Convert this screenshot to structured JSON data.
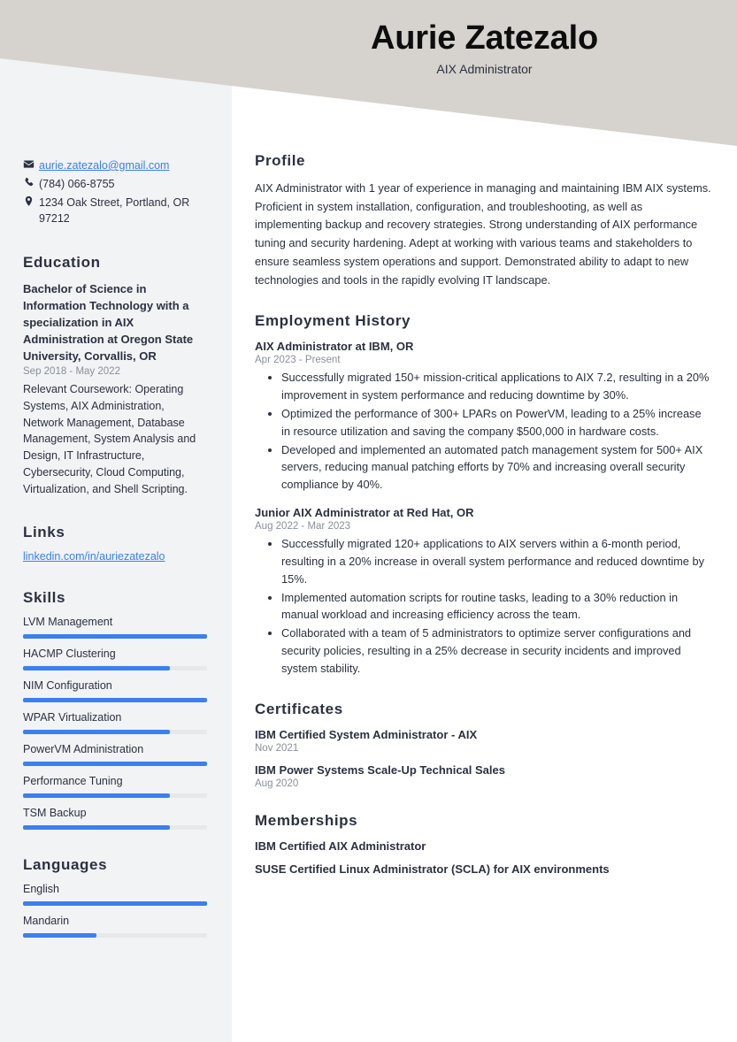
{
  "header": {
    "name": "Aurie Zatezalo",
    "job_title": "AIX Administrator",
    "band_color": "#d6d2cd"
  },
  "theme": {
    "accent": "#3b7ff0",
    "sidebar_bg": "#f1f3f5",
    "text": "#2c3040",
    "muted": "#8a8f98"
  },
  "sidebar": {
    "contact": [
      {
        "icon": "envelope-icon",
        "value": "aurie.zatezalo@gmail.com",
        "is_link": true
      },
      {
        "icon": "phone-icon",
        "value": "(784) 066-8755",
        "is_link": false
      },
      {
        "icon": "location-pin-icon",
        "value": "1234 Oak Street, Portland, OR 97212",
        "is_link": false
      }
    ],
    "education": {
      "heading": "Education",
      "degree": "Bachelor of Science in Information Technology with a specialization in AIX Administration at Oregon State University, Corvallis, OR",
      "date": "Sep 2018 - May 2022",
      "description": "Relevant Coursework: Operating Systems, AIX Administration, Network Management, Database Management, System Analysis and Design, IT Infrastructure, Cybersecurity, Cloud Computing, Virtualization, and Shell Scripting."
    },
    "links": {
      "heading": "Links",
      "items": [
        {
          "label": "linkedin.com/in/auriezatezalo"
        }
      ]
    },
    "skills": {
      "heading": "Skills",
      "items": [
        {
          "label": "LVM Management",
          "level": 100
        },
        {
          "label": "HACMP Clustering",
          "level": 80
        },
        {
          "label": "NIM Configuration",
          "level": 100
        },
        {
          "label": "WPAR Virtualization",
          "level": 80
        },
        {
          "label": "PowerVM Administration",
          "level": 100
        },
        {
          "label": "Performance Tuning",
          "level": 80
        },
        {
          "label": "TSM Backup",
          "level": 80
        }
      ]
    },
    "languages": {
      "heading": "Languages",
      "items": [
        {
          "label": "English",
          "level": 100
        },
        {
          "label": "Mandarin",
          "level": 40
        }
      ]
    }
  },
  "main": {
    "profile": {
      "heading": "Profile",
      "text": "AIX Administrator with 1 year of experience in managing and maintaining IBM AIX systems. Proficient in system installation, configuration, and troubleshooting, as well as implementing backup and recovery strategies. Strong understanding of AIX performance tuning and security hardening. Adept at working with various teams and stakeholders to ensure seamless system operations and support. Demonstrated ability to adapt to new technologies and tools in the rapidly evolving IT landscape."
    },
    "employment": {
      "heading": "Employment History",
      "jobs": [
        {
          "title": "AIX Administrator at IBM, OR",
          "date": "Apr 2023 - Present",
          "bullets": [
            "Successfully migrated 150+ mission-critical applications to AIX 7.2, resulting in a 20% improvement in system performance and reducing downtime by 30%.",
            "Optimized the performance of 300+ LPARs on PowerVM, leading to a 25% increase in resource utilization and saving the company $500,000 in hardware costs.",
            "Developed and implemented an automated patch management system for 500+ AIX servers, reducing manual patching efforts by 70% and increasing overall security compliance by 40%."
          ]
        },
        {
          "title": "Junior AIX Administrator at Red Hat, OR",
          "date": "Aug 2022 - Mar 2023",
          "bullets": [
            "Successfully migrated 120+ applications to AIX servers within a 6-month period, resulting in a 20% increase in overall system performance and reduced downtime by 15%.",
            "Implemented automation scripts for routine tasks, leading to a 30% reduction in manual workload and increasing efficiency across the team.",
            "Collaborated with a team of 5 administrators to optimize server configurations and security policies, resulting in a 25% decrease in security incidents and improved system stability."
          ]
        }
      ]
    },
    "certificates": {
      "heading": "Certificates",
      "items": [
        {
          "name": "IBM Certified System Administrator - AIX",
          "date": "Nov 2021"
        },
        {
          "name": "IBM Power Systems Scale-Up Technical Sales",
          "date": "Aug 2020"
        }
      ]
    },
    "memberships": {
      "heading": "Memberships",
      "items": [
        {
          "name": "IBM Certified AIX Administrator"
        },
        {
          "name": "SUSE Certified Linux Administrator (SCLA) for AIX environments"
        }
      ]
    }
  }
}
